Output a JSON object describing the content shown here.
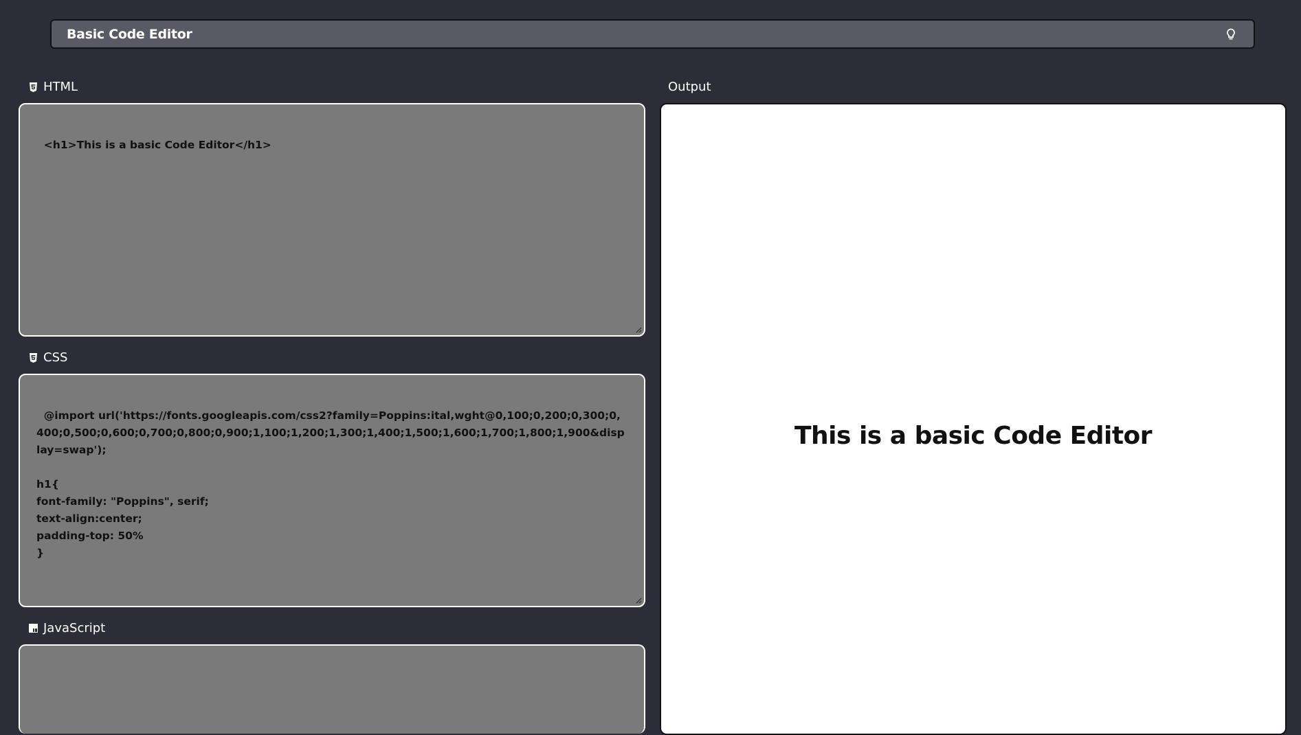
{
  "header": {
    "title": "Basic Code Editor",
    "theme_icon": "lightbulb-icon"
  },
  "panels": {
    "html": {
      "label": "HTML",
      "icon": "html5-icon",
      "code": "<h1>This is a basic Code Editor</h1>"
    },
    "css": {
      "label": "CSS",
      "icon": "css3-icon",
      "code": "@import url('https://fonts.googleapis.com/css2?family=Poppins:ital,wght@0,100;0,200;0,300;0,400;0,500;0,600;0,700;0,800;0,900;1,100;1,200;1,300;1,400;1,500;1,600;1,700;1,800;1,900&display=swap');\n\nh1{\nfont-family: \"Poppins\", serif;\ntext-align:center;\npadding-top: 50%\n}"
    },
    "js": {
      "label": "JavaScript",
      "icon": "javascript-icon",
      "code": ""
    }
  },
  "output": {
    "label": "Output",
    "heading": "This is a basic Code Editor"
  },
  "colors": {
    "background": "#2d2d38",
    "header_bg": "#5a5a65",
    "editor_bg": "#7a7a7a",
    "output_bg": "#ffffff"
  }
}
